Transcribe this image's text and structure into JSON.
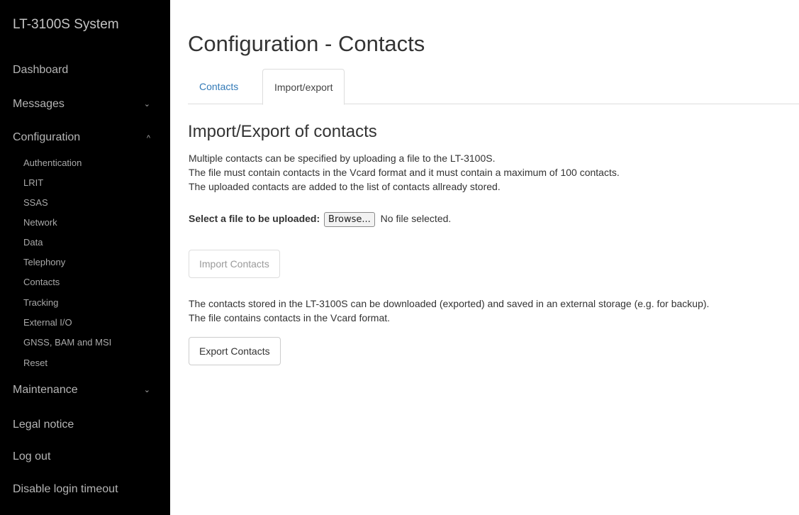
{
  "sidebar": {
    "brand": "LT-3100S System",
    "items": [
      {
        "label": "Dashboard"
      },
      {
        "label": "Messages",
        "chevron": "⌄"
      },
      {
        "label": "Configuration",
        "chevron": "^"
      },
      {
        "label": "Maintenance",
        "chevron": "⌄"
      },
      {
        "label": "Legal notice"
      },
      {
        "label": "Log out"
      },
      {
        "label": "Disable login timeout"
      }
    ],
    "config_subitems": [
      "Authentication",
      "LRIT",
      "SSAS",
      "Network",
      "Data",
      "Telephony",
      "Contacts",
      "Tracking",
      "External I/O",
      "GNSS, BAM and MSI",
      "Reset"
    ]
  },
  "main": {
    "title": "Configuration - Contacts",
    "tabs": [
      {
        "label": "Contacts",
        "active": false
      },
      {
        "label": "Import/export",
        "active": true
      }
    ],
    "section_title": "Import/Export of contacts",
    "intro_lines": [
      "Multiple contacts can be specified by uploading a file to the LT-3100S.",
      "The file must contain contacts in the Vcard format and it must contain a maximum of 100 contacts.",
      "The uploaded contacts are added to the list of contacts allready stored."
    ],
    "upload": {
      "label": "Select a file to be uploaded:",
      "browse_label": "Browse...",
      "status": "No file selected."
    },
    "import_button": "Import Contacts",
    "export_lines": [
      "The contacts stored in the LT-3100S can be downloaded (exported) and saved in an external storage (e.g. for backup).",
      "The file contains contacts in the Vcard format."
    ],
    "export_button": "Export Contacts"
  },
  "colors": {
    "sidebar_bg": "#000000",
    "link_blue": "#337ab7"
  }
}
